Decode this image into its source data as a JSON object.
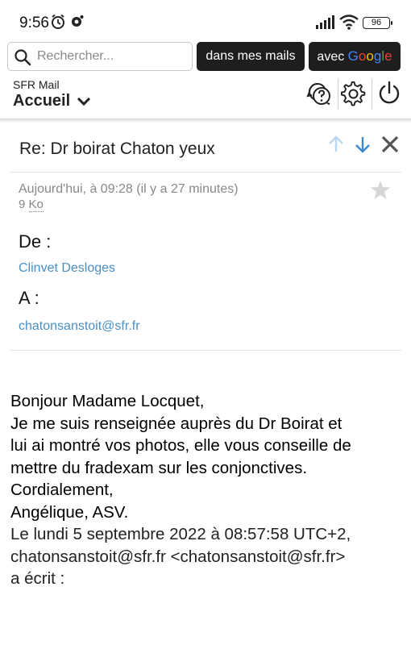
{
  "status_bar": {
    "time": "9:56",
    "battery": "96"
  },
  "search": {
    "placeholder": "Rechercher..."
  },
  "actions": {
    "search_mails_label": "dans mes mails",
    "search_google_prefix": "avec",
    "google_word": [
      "G",
      "o",
      "o",
      "g",
      "l",
      "e"
    ]
  },
  "header": {
    "brand": "SFR Mail",
    "breadcrumb": "Accueil"
  },
  "message": {
    "subject": "Re: Dr boirat Chaton yeux",
    "date": "Aujourd'hui, à 09:28 (il y a 27 minutes)",
    "size_value": "9",
    "size_unit": "Ko",
    "from_label": "De :",
    "from_name": "Clinvet Desloges",
    "to_label": "A :",
    "to_address": "chatonsanstoit@sfr.fr",
    "body_lines": [
      "Bonjour Madame Locquet,",
      "Je me suis renseignée auprès du Dr Boirat et",
      "lui ai montré vos photos, elle vous conseille de",
      "mettre du fradexam sur les conjonctives.",
      "Cordialement,",
      "Angélique, ASV."
    ],
    "quote_lines": [
      "Le lundi 5 septembre 2022 à 08:57:58 UTC+2,",
      "chatonsanstoit@sfr.fr <chatonsanstoit@sfr.fr>",
      "a écrit :"
    ]
  },
  "colors": {
    "accent_blue": "#4a8fc4",
    "arrow_up_disabled": "#b9d7ee",
    "arrow_down": "#3a8ad0",
    "dark_button": "#1e1e1e"
  }
}
